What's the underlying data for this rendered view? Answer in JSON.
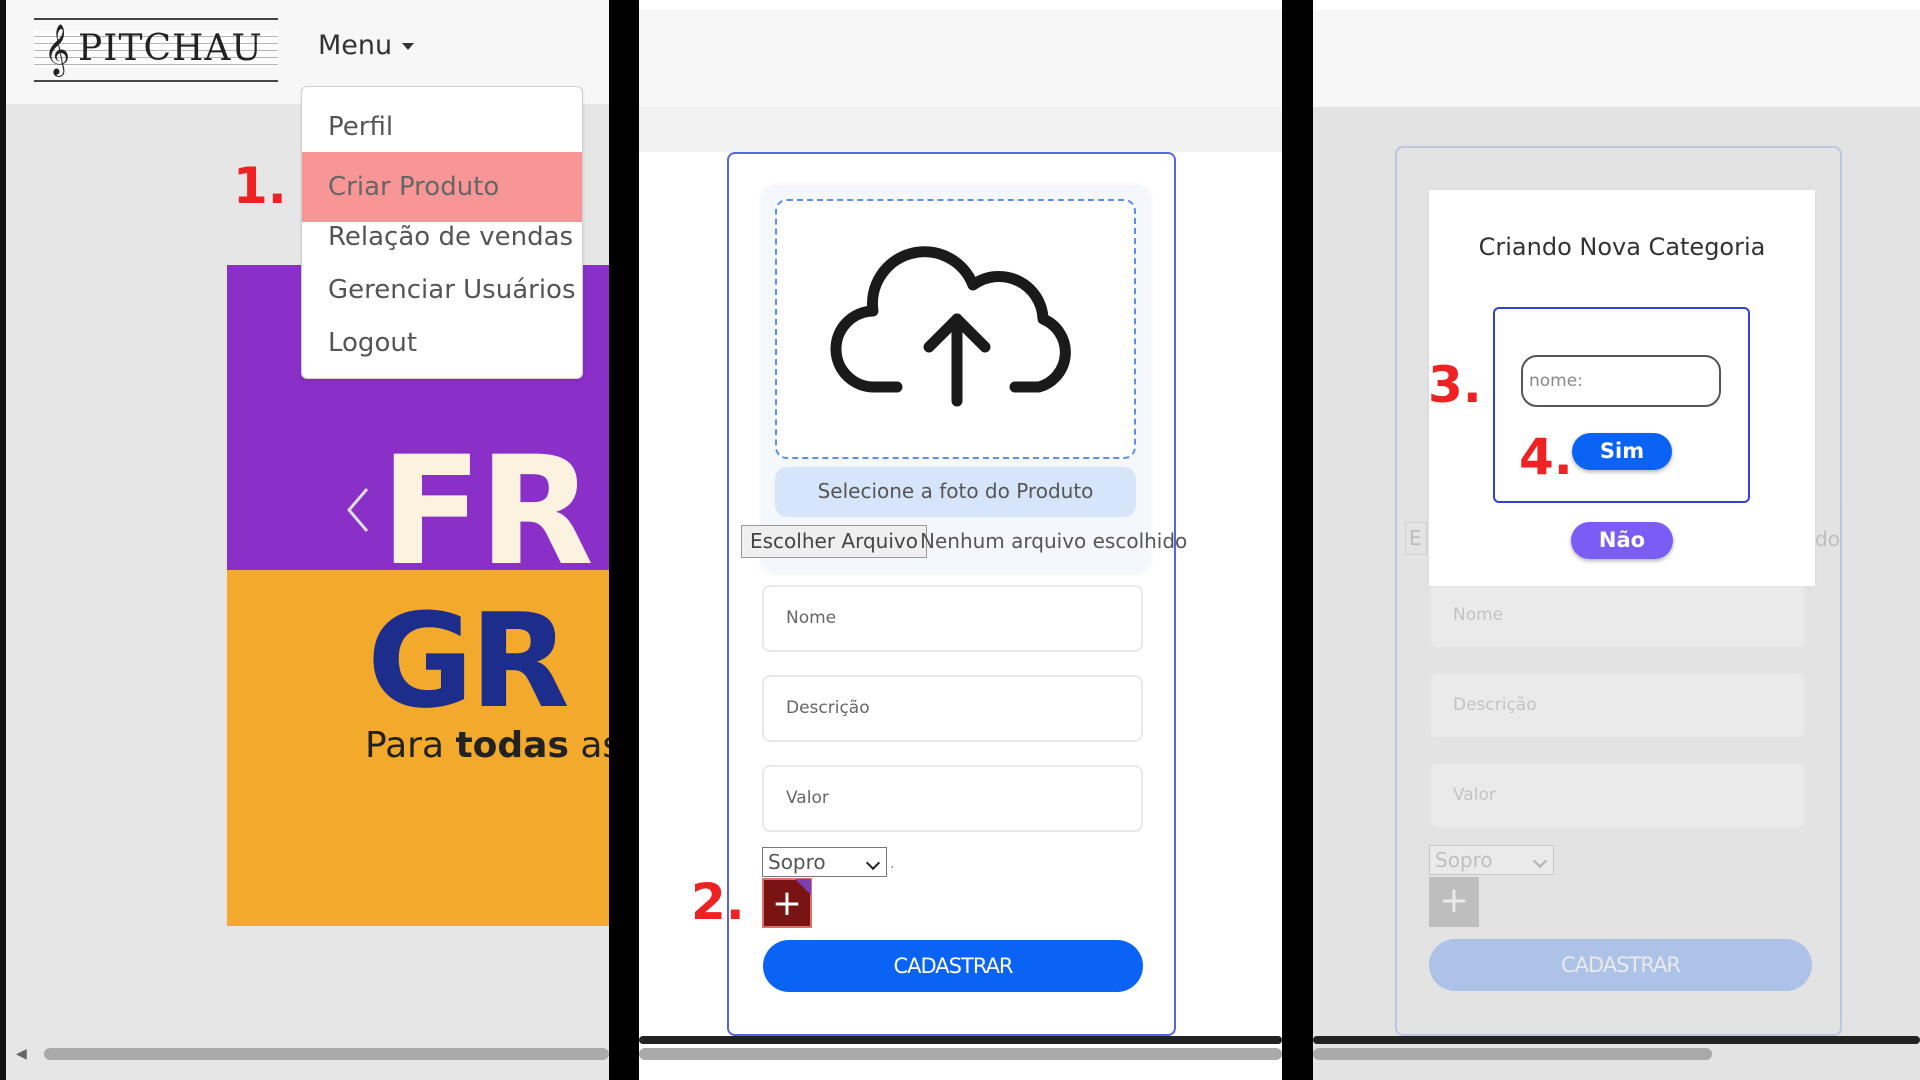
{
  "panel1": {
    "logo_text": "PITCHAU",
    "menu_label": "Menu",
    "menu_items": [
      {
        "label": "Perfil"
      },
      {
        "label": "Criar Produto",
        "active": true
      },
      {
        "label": "Relação de vendas"
      },
      {
        "label": "Gerenciar Usuários"
      },
      {
        "label": "Logout"
      }
    ],
    "step_label": "1.",
    "banner": {
      "line1": "FR",
      "line2": "GR",
      "subtitle_prefix": "Para ",
      "subtitle_bold": "todas",
      "subtitle_suffix": " as"
    }
  },
  "panel2": {
    "upload_label": "Selecione a foto do Produto",
    "file_button": "Escolher Arquivo",
    "file_status": "Nenhum arquivo escolhido",
    "fields": {
      "nome": "Nome",
      "descricao": "Descrição",
      "valor": "Valor"
    },
    "category_selected": "Sopro",
    "add_button_symbol": "+",
    "step_label": "2.",
    "submit_label": "CADASTRAR"
  },
  "panel3": {
    "modal_title": "Criando Nova Categoria",
    "name_placeholder": "nome:",
    "yes_label": "Sim",
    "no_label": "Não",
    "step3_label": "3.",
    "step4_label": "4.",
    "background_form": {
      "file_btn_fragment": "E",
      "file_status_fragment": "do",
      "fields": {
        "nome": "Nome",
        "descricao": "Descrição",
        "valor": "Valor"
      },
      "category_selected": "Sopro",
      "add_button_symbol": "+",
      "submit_label": "CADASTRAR"
    }
  },
  "colors": {
    "highlight_item": "#f89696",
    "step_number": "#ee2222",
    "primary_blue": "#0b63f5",
    "add_button_dark_red": "#7a1313",
    "no_button_purple": "#7b5cf5",
    "form_border": "#5566dd"
  }
}
